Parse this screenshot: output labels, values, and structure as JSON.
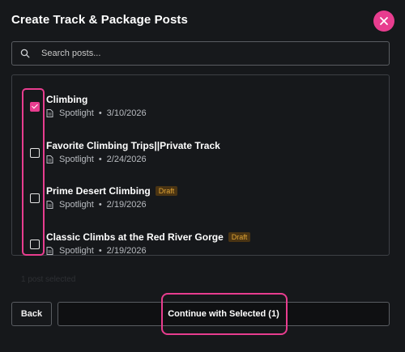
{
  "dialog": {
    "title": "Create Track & Package Posts",
    "close_icon": "close-icon"
  },
  "search": {
    "placeholder": "Search posts...",
    "value": ""
  },
  "posts": [
    {
      "title": "Climbing",
      "badge": "",
      "type": "Spotlight",
      "separator": "•",
      "date": "3/10/2026",
      "checked": true
    },
    {
      "title": "Favorite Climbing Trips||Private Track",
      "badge": "",
      "type": "Spotlight",
      "separator": "•",
      "date": "2/24/2026",
      "checked": false
    },
    {
      "title": "Prime Desert Climbing",
      "badge": "Draft",
      "type": "Spotlight",
      "separator": "•",
      "date": "2/19/2026",
      "checked": false
    },
    {
      "title": "Classic Climbs at the Red River Gorge",
      "badge": "Draft",
      "type": "Spotlight",
      "separator": "•",
      "date": "2/19/2026",
      "checked": false
    }
  ],
  "footer": {
    "selected_info": "1 post selected",
    "back_label": "Back",
    "continue_label": "Continue with Selected (1)"
  },
  "colors": {
    "accent": "#e83d8f",
    "background": "#16181b",
    "draft_badge_bg": "#4a3413",
    "draft_badge_text": "#e0a435"
  }
}
